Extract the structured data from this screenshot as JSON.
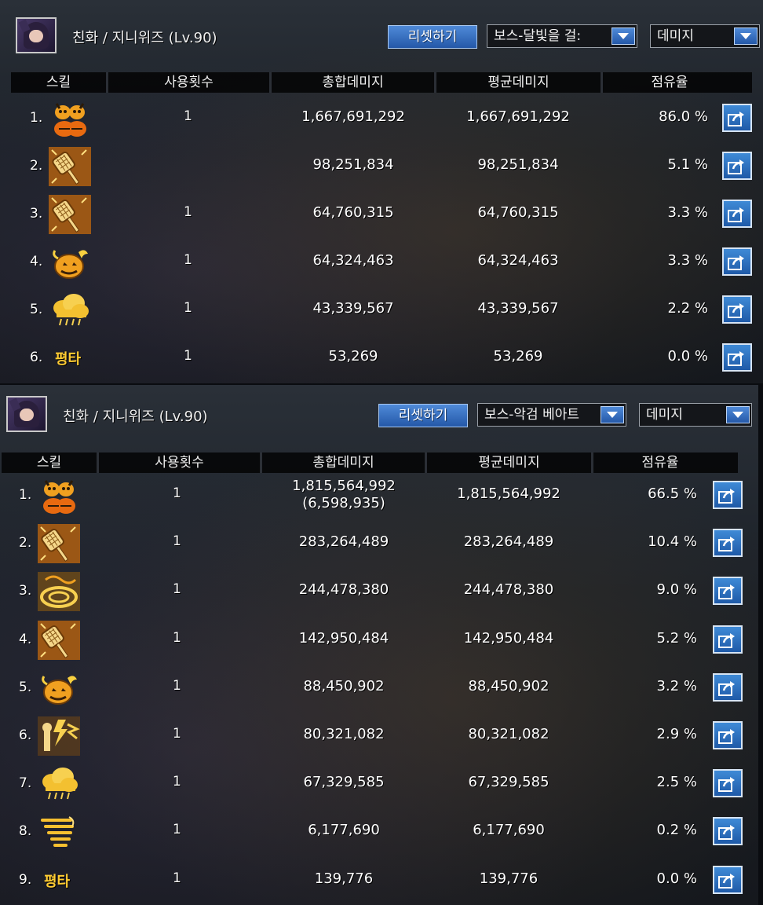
{
  "columns": {
    "skill": "스킬",
    "count": "사용횟수",
    "total": "총합데미지",
    "avg": "평균데미지",
    "share": "점유율"
  },
  "panels": [
    {
      "character": "친화 / 지니위즈 (Lv.90)",
      "reset_label": "리셋하기",
      "boss_select": "보스-달빛을 걸:",
      "metric_select": "데미지",
      "rows": [
        {
          "idx": "1.",
          "icon": "jack-o-lantern-icon",
          "count": "1",
          "total": "1,667,691,292",
          "total_sub": "",
          "avg": "1,667,691,292",
          "share": "86.0 %"
        },
        {
          "idx": "2.",
          "icon": "fly-swatter-icon",
          "count": "",
          "total": "98,251,834",
          "total_sub": "",
          "avg": "98,251,834",
          "share": "5.1 %"
        },
        {
          "idx": "3.",
          "icon": "fly-swatter-icon",
          "count": "1",
          "total": "64,760,315",
          "total_sub": "",
          "avg": "64,760,315",
          "share": "3.3 %"
        },
        {
          "idx": "4.",
          "icon": "pumpkin-bomb-icon",
          "count": "1",
          "total": "64,324,463",
          "total_sub": "",
          "avg": "64,324,463",
          "share": "3.3 %"
        },
        {
          "idx": "5.",
          "icon": "storm-cloud-icon",
          "count": "1",
          "total": "43,339,567",
          "total_sub": "",
          "avg": "43,339,567",
          "share": "2.2 %"
        },
        {
          "idx": "6.",
          "icon": "",
          "label": "평타",
          "count": "1",
          "total": "53,269",
          "total_sub": "",
          "avg": "53,269",
          "share": "0.0 %"
        }
      ]
    },
    {
      "character": "친화 / 지니위즈 (Lv.90)",
      "reset_label": "리셋하기",
      "boss_select": "보스-악검 베아트",
      "metric_select": "데미지",
      "rows": [
        {
          "idx": "1.",
          "icon": "jack-o-lantern-icon",
          "count": "1",
          "total": "1,815,564,992",
          "total_sub": "(6,598,935)",
          "avg": "1,815,564,992",
          "share": "66.5 %"
        },
        {
          "idx": "2.",
          "icon": "fly-swatter-icon",
          "count": "1",
          "total": "283,264,489",
          "total_sub": "",
          "avg": "283,264,489",
          "share": "10.4 %"
        },
        {
          "idx": "3.",
          "icon": "swirl-icon",
          "count": "1",
          "total": "244,478,380",
          "total_sub": "",
          "avg": "244,478,380",
          "share": "9.0 %"
        },
        {
          "idx": "4.",
          "icon": "fly-swatter-icon",
          "count": "1",
          "total": "142,950,484",
          "total_sub": "",
          "avg": "142,950,484",
          "share": "5.2 %"
        },
        {
          "idx": "5.",
          "icon": "pumpkin-bomb-icon",
          "count": "1",
          "total": "88,450,902",
          "total_sub": "",
          "avg": "88,450,902",
          "share": "3.2 %"
        },
        {
          "idx": "6.",
          "icon": "lightning-tower-icon",
          "count": "1",
          "total": "80,321,082",
          "total_sub": "",
          "avg": "80,321,082",
          "share": "2.9 %"
        },
        {
          "idx": "7.",
          "icon": "storm-cloud-icon",
          "count": "1",
          "total": "67,329,585",
          "total_sub": "",
          "avg": "67,329,585",
          "share": "2.5 %"
        },
        {
          "idx": "8.",
          "icon": "whirlwind-icon",
          "count": "1",
          "total": "6,177,690",
          "total_sub": "",
          "avg": "6,177,690",
          "share": "0.2 %"
        },
        {
          "idx": "9.",
          "icon": "",
          "label": "평타",
          "count": "1",
          "total": "139,776",
          "total_sub": "",
          "avg": "139,776",
          "share": "0.0 %"
        }
      ]
    }
  ],
  "colors": {
    "accent_blue": "#2f6fc2",
    "header_bg": "#000000",
    "skill_gold": "#ffcc33"
  }
}
